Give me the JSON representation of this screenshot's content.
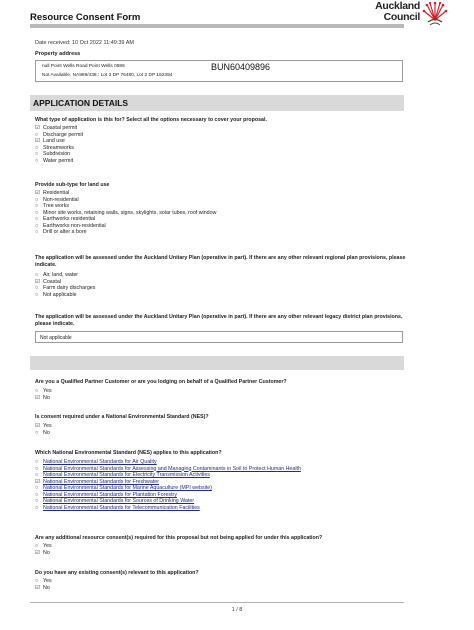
{
  "header": {
    "form_title": "Resource Consent Form",
    "logo_line1": "Auckland",
    "logo_line2": "Council",
    "logo_icon": "pohutukawa-flower-icon",
    "accent_color": "#d32027"
  },
  "meta": {
    "date_received": "Date received: 10 Oct 2022 11:49:39 AM",
    "property_label": "Property address",
    "address_line1": "null Point Wells Road Point Wells 0986",
    "address_line2": "Not Available, NA989/438 : Lot 3 DP 76480, Lot 2 DP 162394",
    "reference": "BUN60409896"
  },
  "sections": {
    "application_details": "APPLICATION DETAILS"
  },
  "questions": {
    "application_type": {
      "label": "What type of application is this for? Select all the options necessary to cover your proposal.",
      "options": [
        {
          "label": "Coastal permit",
          "checked": true
        },
        {
          "label": "Discharge permit",
          "checked": false
        },
        {
          "label": "Land use",
          "checked": true
        },
        {
          "label": "Streamworks",
          "checked": false
        },
        {
          "label": "Subdivision",
          "checked": false
        },
        {
          "label": "Water permit",
          "checked": false
        }
      ]
    },
    "land_use_subtype": {
      "label": "Provide sub-type for land use",
      "options": [
        {
          "label": "Residential",
          "checked": true
        },
        {
          "label": "Non-residential",
          "checked": false
        },
        {
          "label": "Tree works",
          "checked": false
        },
        {
          "label": "Minor site works, retaining walls, signs, skylights, solar tubes, roof window",
          "checked": false
        },
        {
          "label": "Earthworks residential",
          "checked": false
        },
        {
          "label": "Earthworks non-residential",
          "checked": false
        },
        {
          "label": "Drill or alter a bore",
          "checked": false
        }
      ]
    },
    "regional_provisions": {
      "label": "The application will be assessed under the Auckland Unitary Plan (operative in part). If there are any other relevant regional plan provisions, please indicate.",
      "options": [
        {
          "label": "Air, land, water",
          "checked": false
        },
        {
          "label": "Coastal",
          "checked": true
        },
        {
          "label": "Farm dairy discharges",
          "checked": false
        },
        {
          "label": "Not applicable",
          "checked": false
        }
      ]
    },
    "district_provisions": {
      "label": "The application will be assessed under the Auckland Unitary Plan (operative in part). If there are any other relevant legacy district plan provisions, please indicate.",
      "answer": "Not applicable"
    },
    "qualified_partner": {
      "label": "Are you a Qualified Partner Customer or are you lodging on behalf of a Qualified Partner Customer?",
      "options": [
        {
          "label": "Yes",
          "checked": false
        },
        {
          "label": "No",
          "checked": true
        }
      ]
    },
    "nes_required": {
      "label": "Is consent required under a National Environmental Standard (NES)?",
      "options": [
        {
          "label": "Yes",
          "checked": true
        },
        {
          "label": "No",
          "checked": false
        }
      ]
    },
    "nes_applies": {
      "label": "Which National Environmental Standard (NES) applies to this application?",
      "options": [
        {
          "label": "National Environmental Standards for Air Quality",
          "checked": false
        },
        {
          "label": "National Environmental Standards for Assessing and Managing Contaminants in Soil to Protect Human Health",
          "checked": false
        },
        {
          "label": "National Environmental Standards for Electricity Transmission Activities",
          "checked": false
        },
        {
          "label": "National Environmental Standards for Freshwater",
          "checked": true
        },
        {
          "label": "National Environmental Standards for Marine Aquaculture (MPI website)",
          "checked": false
        },
        {
          "label": "National Environmental Standards for Plantation Forestry",
          "checked": false
        },
        {
          "label": "National Environmental Standards for Sources of Drinking Water",
          "checked": false
        },
        {
          "label": "National Environmental Standards for Telecommunication Facilities",
          "checked": false
        }
      ]
    },
    "additional_consents": {
      "label": "Are any additional resource consent(s) required for this proposal but not being applied for under this application?",
      "options": [
        {
          "label": "Yes",
          "checked": false
        },
        {
          "label": "No",
          "checked": true
        }
      ]
    },
    "existing_consents": {
      "label": "Do you have any existing consent(s) relevant to this application?",
      "options": [
        {
          "label": "Yes",
          "checked": false
        },
        {
          "label": "No",
          "checked": true
        }
      ]
    }
  },
  "footer": {
    "page_number": "1 / 8"
  }
}
